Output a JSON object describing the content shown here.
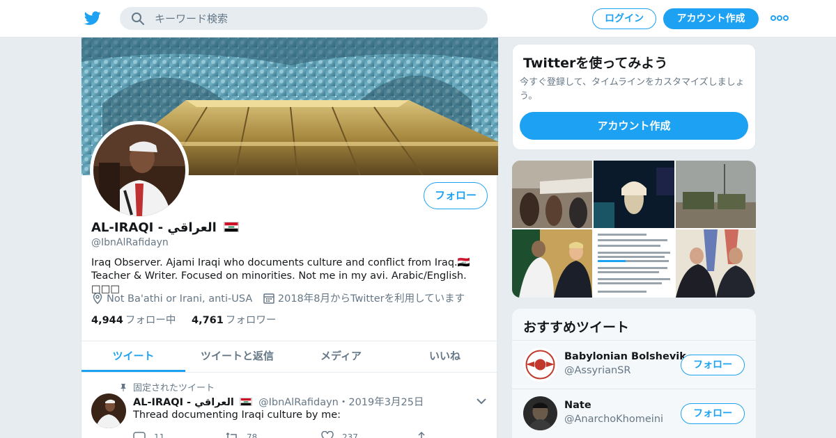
{
  "nav": {
    "search_placeholder": "キーワード検索",
    "login_label": "ログイン",
    "signup_label": "アカウント作成",
    "icons": [
      "twitter-bird-icon",
      "search-icon",
      "more-dots-icon"
    ]
  },
  "profile": {
    "name": "AL-IRAQI - العراقي",
    "handle": "@IbnAlRafidayn",
    "bio": "Iraq Observer. Ajami Iraqi who documents culture and conflict from Iraq.🇮🇶 Teacher & Writer. Focused on minorities. Not me in my avi. Arabic/English. □□□",
    "location": "Not Ba'athi or Irani, anti-USA",
    "joined": "2018年8月からTwitterを利用しています",
    "following_count": "4,944",
    "following_label": "フォロー中",
    "followers_count": "4,761",
    "followers_label": "フォロワー",
    "follow_label": "フォロー",
    "tabs": [
      "ツイート",
      "ツイートと返信",
      "メディア",
      "いいね"
    ],
    "active_tab": "ツイート"
  },
  "pinned_tweet": {
    "pinned_label": "固定されたツイート",
    "name": "AL-IRAQI - العراقي",
    "handle_date": "@IbnAlRafidayn・2019年3月25日",
    "text": "Thread documenting Iraqi culture by me:",
    "replies": "11",
    "retweets": "78",
    "likes": "237"
  },
  "signup_card": {
    "title": "Twitterを使ってみよう",
    "subtitle": "今すぐ登録して、タイムラインをカスタマイズしましょう。",
    "button": "アカウント作成"
  },
  "recommended": {
    "title": "おすすめツイート",
    "items": [
      {
        "name": "Babylonian Bolshevik",
        "handle": "@AssyrianSR",
        "follow": "フォロー"
      },
      {
        "name": "Nate",
        "handle": "@AnarchoKhomeini",
        "follow": "フォロー"
      }
    ]
  },
  "colors": {
    "accent": "#1da1f2",
    "background": "#e6ecf0",
    "muted": "#657786"
  }
}
